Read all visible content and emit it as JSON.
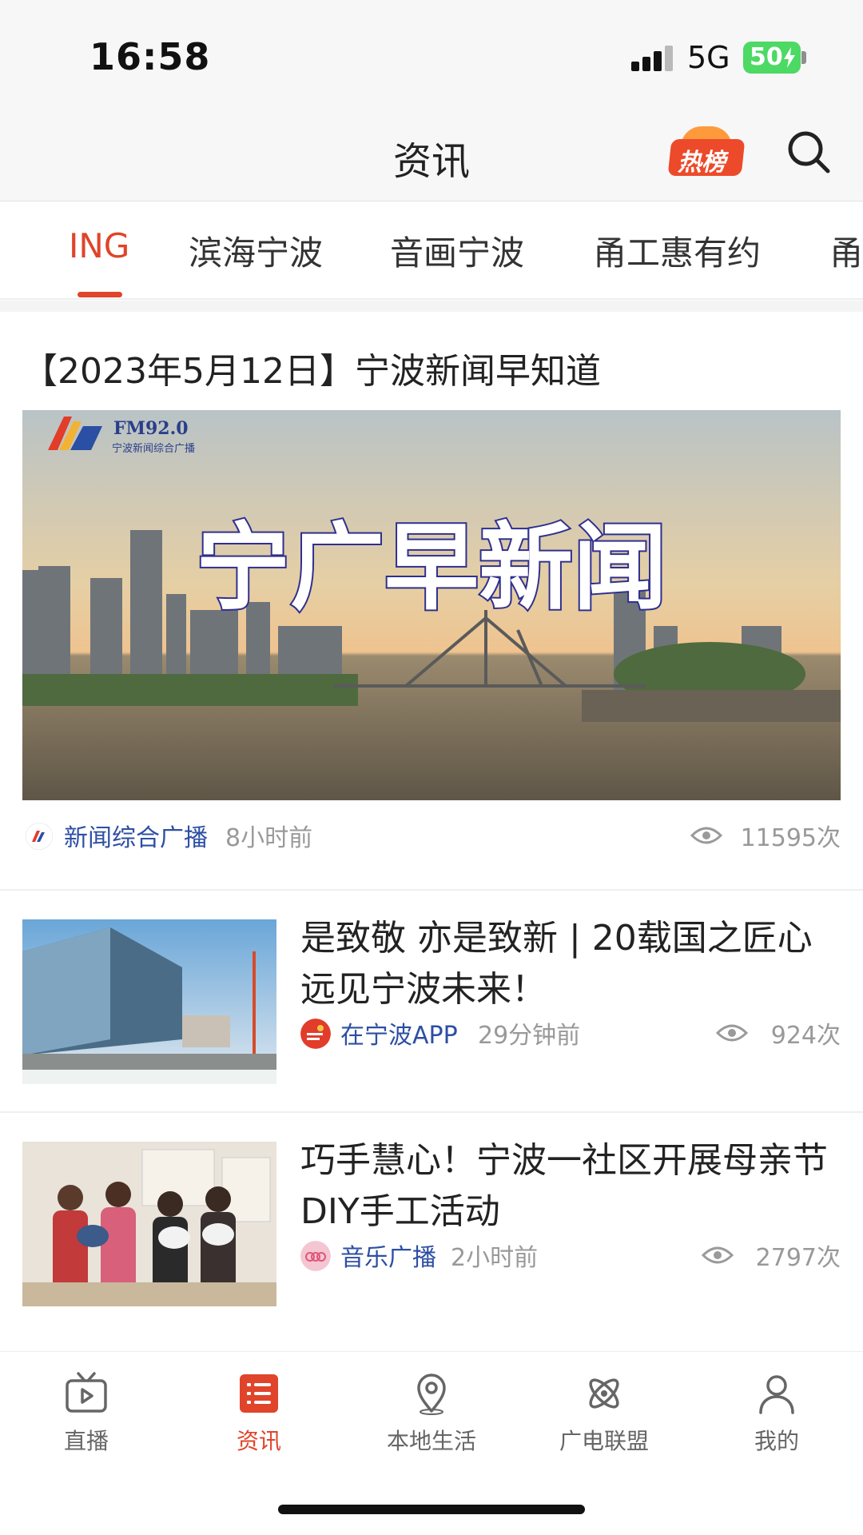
{
  "status_bar": {
    "time": "16:58",
    "network": "5G",
    "battery": "50"
  },
  "header": {
    "title": "资讯",
    "hot_label": "热榜"
  },
  "tabs": [
    {
      "label": "ING",
      "active": true
    },
    {
      "label": "滨海宁波"
    },
    {
      "label": "音画宁波"
    },
    {
      "label": "甬工惠有约"
    },
    {
      "label": "甬"
    }
  ],
  "featured": {
    "title": "【2023年5月12日】宁波新闻早知道",
    "image": {
      "station_code": "FM92.0",
      "station_name": "宁波新闻综合广播",
      "headline": "宁广早新闻"
    },
    "source": "新闻综合广播",
    "time": "8小时前",
    "views": "11595次"
  },
  "articles": [
    {
      "title": "是致敬 亦是致新 | 20载国之匠心 远见宁波未来！",
      "source": "在宁波APP",
      "time": "29分钟前",
      "views": "924次"
    },
    {
      "title": "巧手慧心！宁波一社区开展母亲节DIY手工活动",
      "source": "音乐广播",
      "time": "2小时前",
      "views": "2797次"
    }
  ],
  "bottom_nav": [
    {
      "label": "直播",
      "icon": "tv-icon"
    },
    {
      "label": "资讯",
      "icon": "news-list-icon",
      "active": true
    },
    {
      "label": "本地生活",
      "icon": "map-pin-icon"
    },
    {
      "label": "广电联盟",
      "icon": "atom-icon"
    },
    {
      "label": "我的",
      "icon": "user-icon"
    }
  ],
  "colors": {
    "accent": "#e0442a",
    "source_blue": "#2d4fa3",
    "battery_green": "#4cd964"
  }
}
